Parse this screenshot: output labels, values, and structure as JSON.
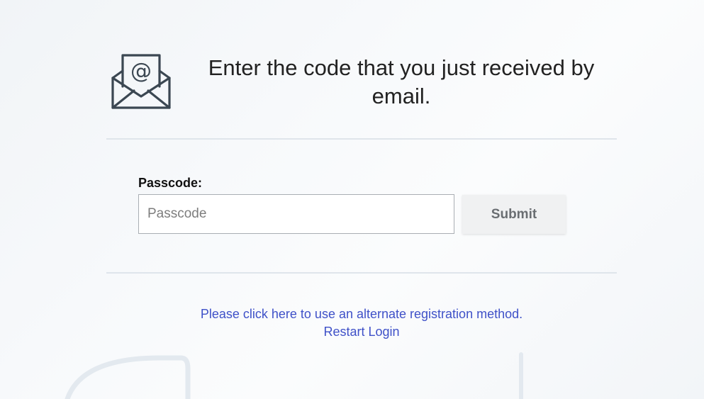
{
  "header": {
    "icon": "email-envelope-at-icon",
    "title": "Enter the code that you just received by email."
  },
  "form": {
    "passcode_label": "Passcode:",
    "passcode_value": "",
    "passcode_placeholder": "Passcode",
    "submit_label": "Submit"
  },
  "links": {
    "alternate_method": "Please click here to use an alternate registration method.",
    "restart_login": "Restart Login"
  },
  "colors": {
    "link": "#3f51c8",
    "divider": "#dfe5eb",
    "button_bg": "#f0f1f2",
    "button_text": "#6a6e72"
  }
}
